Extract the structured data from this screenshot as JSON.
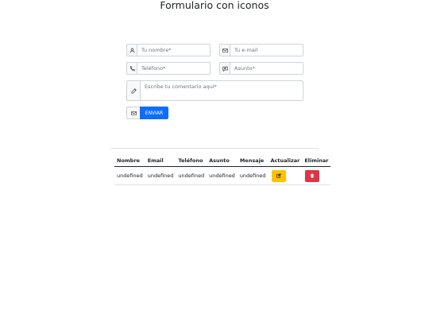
{
  "page": {
    "title": "Formulario con iconos"
  },
  "form": {
    "name": {
      "placeholder": "Tu nombre*",
      "value": "",
      "icon": "user-icon"
    },
    "email": {
      "placeholder": "Tu e-mail",
      "value": "",
      "icon": "envelope-icon"
    },
    "phone": {
      "placeholder": "Teléfono*",
      "value": "",
      "icon": "phone-icon"
    },
    "subject": {
      "placeholder": "Asunto*",
      "value": "",
      "icon": "chat-icon"
    },
    "comment": {
      "placeholder": "Escribe tu comentario aquí*",
      "value": "",
      "icon": "pencil-icon"
    },
    "send": {
      "label": "ENVIAR",
      "icon": "envelope-icon",
      "color": "#0d6efd"
    }
  },
  "table": {
    "headers": [
      "Nombre",
      "Email",
      "Teléfono",
      "Asunto",
      "Mensaje",
      "Actualizar",
      "Eliminar"
    ],
    "rows": [
      {
        "nombre": "undefined",
        "email": "undefined",
        "telefono": "undefined",
        "asunto": "undefined",
        "mensaje": "undefined",
        "update_icon": "edit-icon",
        "delete_icon": "trash-icon"
      }
    ],
    "update_color": "#ffc107",
    "delete_color": "#dc3545"
  }
}
